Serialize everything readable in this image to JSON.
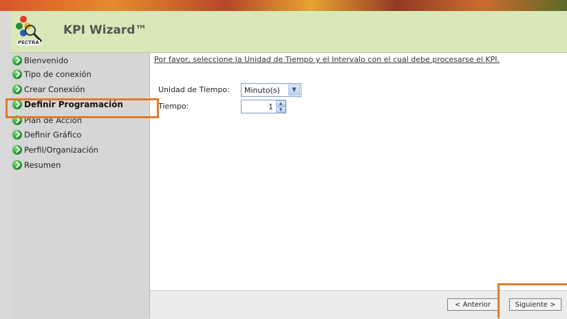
{
  "app": {
    "title": "KPI Wizard™",
    "logo_text": "PECTRA"
  },
  "sidebar": {
    "items": [
      {
        "label": "Bienvenido",
        "active": false
      },
      {
        "label": "Tipo de conexión",
        "active": false
      },
      {
        "label": "Crear Conexión",
        "active": false
      },
      {
        "label": "Definir Programación",
        "active": true
      },
      {
        "label": "Plan de Acción",
        "active": false
      },
      {
        "label": "Definir Gráfico",
        "active": false
      },
      {
        "label": "Perfil/Organización",
        "active": false
      },
      {
        "label": "Resumen",
        "active": false
      }
    ]
  },
  "content": {
    "instruction": "Por favor, seleccione la Unidad de Tiempo y el Intervalo con el cual debe procesarse el KPI.",
    "time_unit": {
      "label": "Unidad de Tiempo:",
      "value": "Minuto(s)"
    },
    "interval": {
      "label": "Tiempo:",
      "value": "1"
    }
  },
  "footer": {
    "prev_label": "< Anterior",
    "next_label": "Siguiente >"
  },
  "colors": {
    "header_bg": "#d8e8b8",
    "sidebar_bg": "#d6d6d6",
    "highlight": "#e07a2a",
    "nav_icon": "#1b8a2a"
  }
}
